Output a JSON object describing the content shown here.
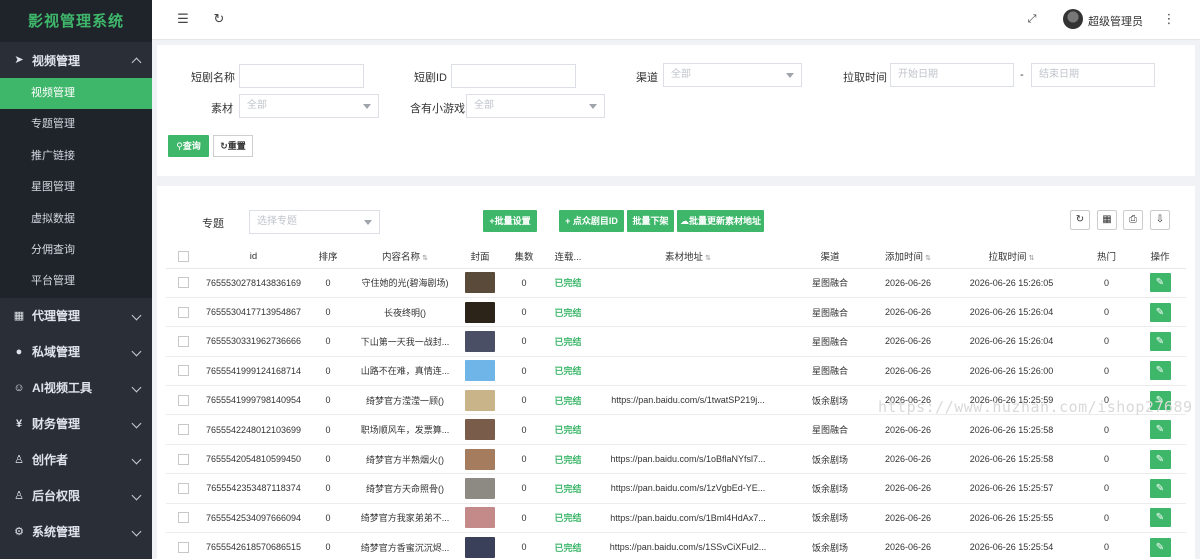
{
  "app": {
    "title": "影视管理系统"
  },
  "sidebar": {
    "groups": [
      {
        "label": "视频管理",
        "icon": "paper-plane-icon",
        "expanded": true,
        "items": [
          {
            "label": "视频管理",
            "active": true
          },
          {
            "label": "专题管理"
          },
          {
            "label": "推广链接"
          },
          {
            "label": "星图管理"
          },
          {
            "label": "虚拟数据"
          },
          {
            "label": "分佣查询"
          },
          {
            "label": "平台管理"
          }
        ]
      },
      {
        "label": "代理管理",
        "icon": "grid-icon"
      },
      {
        "label": "私域管理",
        "icon": "chat-icon"
      },
      {
        "label": "AI视频工具",
        "icon": "smile-icon"
      },
      {
        "label": "财务管理",
        "icon": "money-icon"
      },
      {
        "label": "创作者",
        "icon": "user-icon"
      },
      {
        "label": "后台权限",
        "icon": "user-lock-icon"
      },
      {
        "label": "系统管理",
        "icon": "cog-icon"
      }
    ]
  },
  "header": {
    "username": "超级管理员"
  },
  "search": {
    "drama_name_label": "短剧名称",
    "drama_id_label": "短剧ID",
    "channel_label": "渠道",
    "channel_value": "全部",
    "pull_time_label": "拉取时间",
    "start_date_placeholder": "开始日期",
    "date_separator": "-",
    "end_date_placeholder": "结束日期",
    "material_label": "素材",
    "material_value": "全部",
    "mini_game_label": "含有小游戏",
    "mini_game_value": "全部",
    "query_button": "查询",
    "reset_button": "重置"
  },
  "toolbar": {
    "topic_label": "专题",
    "topic_placeholder": "选择专题",
    "batch_settings": "+批量设置",
    "dianzhong_id": "+ 点众剧目ID",
    "batch_offline": "批量下架",
    "batch_update_material": "批量更新素材地址"
  },
  "table": {
    "headers": [
      "id",
      "排序",
      "内容名称",
      "封面",
      "集数",
      "连载...",
      "素材地址",
      "渠道",
      "添加时间",
      "拉取时间",
      "热门",
      "操作"
    ],
    "rows": [
      {
        "id": "7655530278143836169",
        "sort": "0",
        "name": "守住她的光(碧海剧场)",
        "cover": "#5a4a3a",
        "episodes": "0",
        "status": "已完结",
        "material": "",
        "channel": "星图融合",
        "added": "2026-06-26",
        "pulled": "2026-06-26 15:26:05",
        "hot": "0"
      },
      {
        "id": "7655530417713954867",
        "sort": "0",
        "name": "长夜终明()",
        "cover": "#2c2418",
        "episodes": "0",
        "status": "已完结",
        "material": "",
        "channel": "星图融合",
        "added": "2026-06-26",
        "pulled": "2026-06-26 15:26:04",
        "hot": "0"
      },
      {
        "id": "7655530331962736666",
        "sort": "0",
        "name": "下山第一天我一战封...",
        "cover": "#4a4f66",
        "episodes": "0",
        "status": "已完结",
        "material": "",
        "channel": "星图融合",
        "added": "2026-06-26",
        "pulled": "2026-06-26 15:26:04",
        "hot": "0"
      },
      {
        "id": "7655541999124168714",
        "sort": "0",
        "name": "山路不在难，真情连...",
        "cover": "#6fb5e8",
        "episodes": "0",
        "status": "已完结",
        "material": "",
        "channel": "星图融合",
        "added": "2026-06-26",
        "pulled": "2026-06-26 15:26:00",
        "hot": "0"
      },
      {
        "id": "7655541999798140954",
        "sort": "0",
        "name": "绮梦官方滢滢一顾()",
        "cover": "#c9b48a",
        "episodes": "0",
        "status": "已完结",
        "material": "https://pan.baidu.com/s/1twatSP219j...",
        "channel": "饭余剧场",
        "added": "2026-06-26",
        "pulled": "2026-06-26 15:25:59",
        "hot": "0"
      },
      {
        "id": "7655542248012103699",
        "sort": "0",
        "name": "职场顺风车，发票算...",
        "cover": "#7a5c4a",
        "episodes": "0",
        "status": "已完结",
        "material": "",
        "channel": "星图融合",
        "added": "2026-06-26",
        "pulled": "2026-06-26 15:25:58",
        "hot": "0"
      },
      {
        "id": "7655542054810599450",
        "sort": "0",
        "name": "绮梦官方半熟烟火()",
        "cover": "#a57c5e",
        "episodes": "0",
        "status": "已完结",
        "material": "https://pan.baidu.com/s/1oBflaNYfsl7...",
        "channel": "饭余剧场",
        "added": "2026-06-26",
        "pulled": "2026-06-26 15:25:58",
        "hot": "0"
      },
      {
        "id": "7655542353487118374",
        "sort": "0",
        "name": "绮梦官方天命照骨()",
        "cover": "#8d8a84",
        "episodes": "0",
        "status": "已完结",
        "material": "https://pan.baidu.com/s/1zVgbEd-YE...",
        "channel": "饭余剧场",
        "added": "2026-06-26",
        "pulled": "2026-06-26 15:25:57",
        "hot": "0"
      },
      {
        "id": "7655542534097666094",
        "sort": "0",
        "name": "绮梦官方我家弟弟不...",
        "cover": "#c48a8a",
        "episodes": "0",
        "status": "已完结",
        "material": "https://pan.baidu.com/s/1Bml4HdAx7...",
        "channel": "饭余剧场",
        "added": "2026-06-26",
        "pulled": "2026-06-26 15:25:55",
        "hot": "0"
      },
      {
        "id": "7655542618570686515",
        "sort": "0",
        "name": "绮梦官方香蜜沉沉烬...",
        "cover": "#3a3f5a",
        "episodes": "0",
        "status": "已完结",
        "material": "https://pan.baidu.com/s/1SSvCiXFul2...",
        "channel": "饭余剧场",
        "added": "2026-06-26",
        "pulled": "2026-06-26 15:25:54",
        "hot": "0"
      }
    ]
  },
  "watermark": "https://www.huzhan.com/ishop27689",
  "colors": {
    "accent": "#3fb76b",
    "sidebar": "#2a2f37"
  }
}
